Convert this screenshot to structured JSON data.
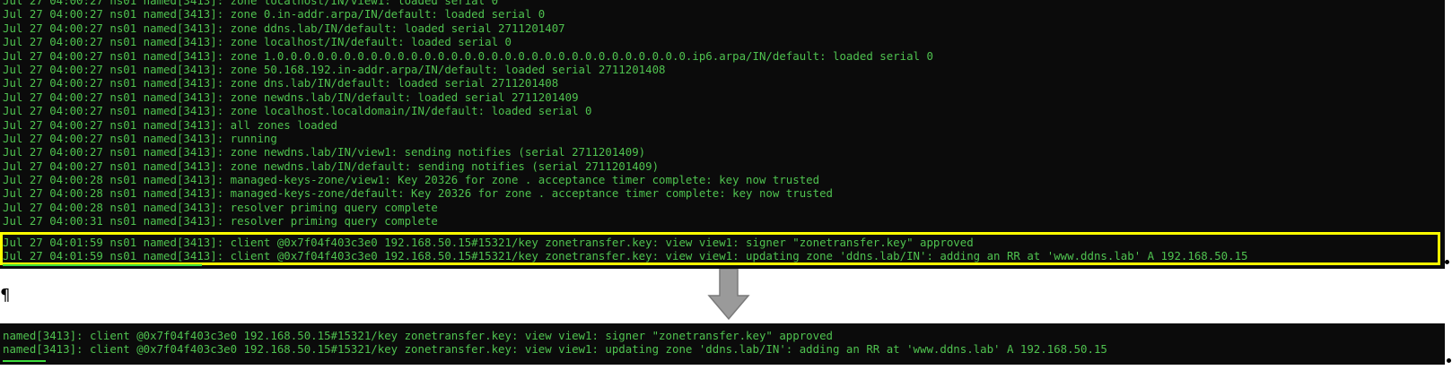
{
  "terminal_top": {
    "lines": [
      "Jul 27 04:00:27 ns01 named[3413]: zone localhost/IN/view1: loaded serial 0",
      "Jul 27 04:00:27 ns01 named[3413]: zone 0.in-addr.arpa/IN/default: loaded serial 0",
      "Jul 27 04:00:27 ns01 named[3413]: zone ddns.lab/IN/default: loaded serial 2711201407",
      "Jul 27 04:00:27 ns01 named[3413]: zone localhost/IN/default: loaded serial 0",
      "Jul 27 04:00:27 ns01 named[3413]: zone 1.0.0.0.0.0.0.0.0.0.0.0.0.0.0.0.0.0.0.0.0.0.0.0.0.0.0.0.0.0.0.0.ip6.arpa/IN/default: loaded serial 0",
      "Jul 27 04:00:27 ns01 named[3413]: zone 50.168.192.in-addr.arpa/IN/default: loaded serial 2711201408",
      "Jul 27 04:00:27 ns01 named[3413]: zone dns.lab/IN/default: loaded serial 2711201408",
      "Jul 27 04:00:27 ns01 named[3413]: zone newdns.lab/IN/default: loaded serial 2711201409",
      "Jul 27 04:00:27 ns01 named[3413]: zone localhost.localdomain/IN/default: loaded serial 0",
      "Jul 27 04:00:27 ns01 named[3413]: all zones loaded",
      "Jul 27 04:00:27 ns01 named[3413]: running",
      "Jul 27 04:00:27 ns01 named[3413]: zone newdns.lab/IN/view1: sending notifies (serial 2711201409)",
      "Jul 27 04:00:27 ns01 named[3413]: zone newdns.lab/IN/default: sending notifies (serial 2711201409)",
      "Jul 27 04:00:28 ns01 named[3413]: managed-keys-zone/view1: Key 20326 for zone . acceptance timer complete: key now trusted",
      "Jul 27 04:00:28 ns01 named[3413]: managed-keys-zone/default: Key 20326 for zone . acceptance timer complete: key now trusted",
      "Jul 27 04:00:28 ns01 named[3413]: resolver priming query complete",
      "Jul 27 04:00:31 ns01 named[3413]: resolver priming query complete"
    ],
    "highlighted_lines": [
      "Jul 27 04:01:59 ns01 named[3413]: client @0x7f04f403c3e0 192.168.50.15#15321/key zonetransfer.key: view view1: signer \"zonetransfer.key\" approved",
      "Jul 27 04:01:59 ns01 named[3413]: client @0x7f04f403c3e0 192.168.50.15#15321/key zonetransfer.key: view view1: updating zone 'ddns.lab/IN': adding an RR at 'www.ddns.lab' A 192.168.50.15"
    ]
  },
  "pilcrow": "¶",
  "terminal_bottom": {
    "lines": [
      "named[3413]: client @0x7f04f403c3e0 192.168.50.15#15321/key zonetransfer.key: view view1: signer \"zonetransfer.key\" approved",
      "named[3413]: client @0x7f04f403c3e0 192.168.50.15#15321/key zonetransfer.key: view view1: updating zone 'ddns.lab/IN': adding an RR at 'www.ddns.lab' A 192.168.50.15"
    ]
  },
  "colors": {
    "terminal_bg": "#0b0b0b",
    "terminal_text": "#4fc24f",
    "highlight_border": "#ffff00",
    "arrow_fill": "#9a9a9a"
  },
  "icons": {
    "arrow": "down-arrow-icon"
  }
}
